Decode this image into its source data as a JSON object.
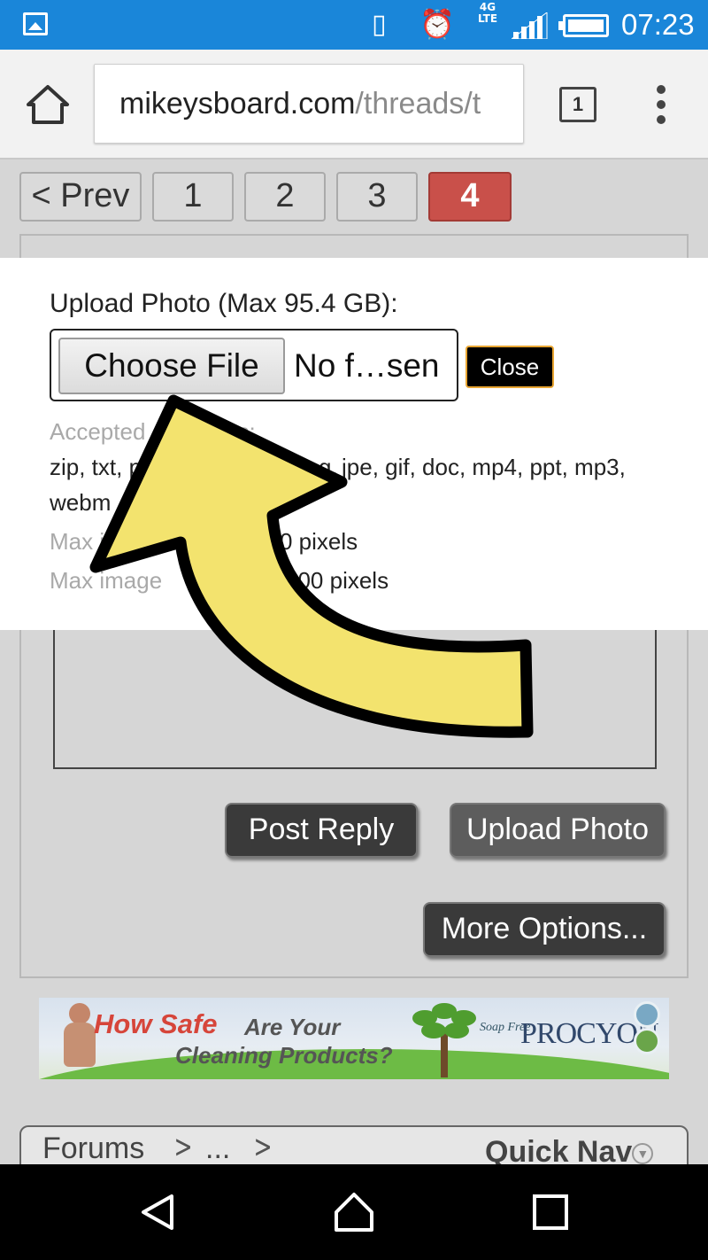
{
  "status_bar": {
    "network": "4G",
    "network_sub": "LTE",
    "time": "07:23",
    "icons": [
      "gallery-icon",
      "vibrate-icon",
      "alarm-icon",
      "signal-icon",
      "battery-icon"
    ]
  },
  "browser": {
    "url_domain": "mikeysboard.com",
    "url_path": "/threads/t",
    "tab_count": "1",
    "icons": [
      "home-icon",
      "tabs-icon",
      "overflow-menu-icon"
    ]
  },
  "pagination": {
    "prev_label": "< Prev",
    "pages": [
      "1",
      "2",
      "3",
      "4"
    ],
    "current_page": "4",
    "active_color": "#c9504a"
  },
  "upload_dialog": {
    "title": "Upload Photo (Max 95.4 GB):",
    "choose_file_label": "Choose File",
    "file_status": "No f…sen",
    "close_label": "Close",
    "accepted_label": "Accepted",
    "accepted_label_tail": "es:",
    "extensions_line1_start": "zip, txt, p",
    "extensions_line1_end": "jpe, gif, doc, mp4, ppt, mp3,",
    "extensions_line2": "webm",
    "mid_fragment": "g,",
    "max1_label": "Max i",
    "max1_value": "0 pixels",
    "max2_label": "Max image",
    "max2_value": "000 pixels"
  },
  "reply_actions": {
    "post_reply": "Post Reply",
    "upload_photo": "Upload Photo",
    "more_options": "More Options..."
  },
  "ad_banner": {
    "headline_red": "How Safe",
    "headline_gray_1": "Are Your",
    "headline_gray_2": "Cleaning Products?",
    "brand_small": "Soap Free",
    "brand": "PROCYON",
    "brand_color": "#31486b",
    "headline_color": "#d6453a"
  },
  "breadcrumb": {
    "items": [
      "Forums",
      "..."
    ],
    "quick_nav": "Quick Nav"
  },
  "annotation": {
    "arrow_color": "#f3e36e",
    "arrow_points_to": "Choose File"
  },
  "nav_bar": {
    "icons": [
      "back-icon",
      "home-icon",
      "recents-icon"
    ]
  }
}
